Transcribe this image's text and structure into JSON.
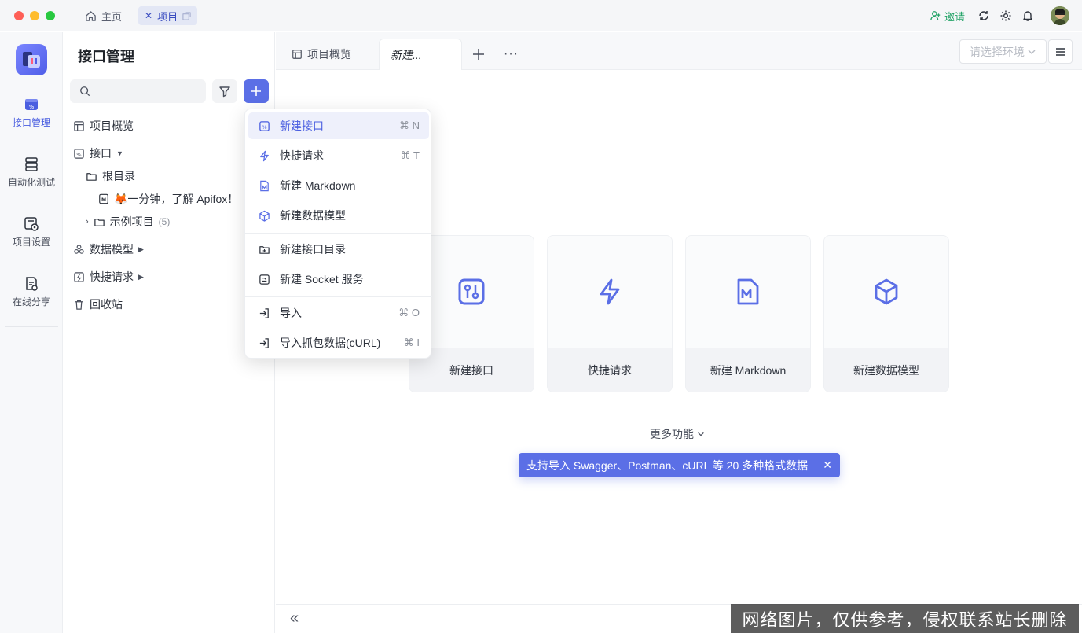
{
  "titlebar": {
    "home_label": "主页",
    "project_tab_label": "项目",
    "invite_label": "邀请"
  },
  "rail": {
    "items": [
      {
        "label": "接口管理"
      },
      {
        "label": "自动化测试"
      },
      {
        "label": "项目设置"
      },
      {
        "label": "在线分享"
      }
    ]
  },
  "sidebar": {
    "title": "接口管理",
    "search_placeholder": "",
    "tree": {
      "overview": "项目概览",
      "api": "接口",
      "root_dir": "根目录",
      "doc_item": "🦊一分钟，了解 Apifox！",
      "example_folder": "示例项目",
      "example_count": "(5)",
      "data_model": "数据模型",
      "quick_request": "快捷请求",
      "recycle": "回收站"
    }
  },
  "tabs": {
    "overview": "项目概览",
    "new": "新建..."
  },
  "env_select": {
    "placeholder": "请选择环境"
  },
  "dropdown": {
    "items": [
      {
        "label": "新建接口",
        "shortcut": "⌘ N"
      },
      {
        "label": "快捷请求",
        "shortcut": "⌘ T"
      },
      {
        "label": "新建 Markdown",
        "shortcut": ""
      },
      {
        "label": "新建数据模型",
        "shortcut": ""
      },
      {
        "label": "新建接口目录",
        "shortcut": ""
      },
      {
        "label": "新建 Socket 服务",
        "shortcut": ""
      },
      {
        "label": "导入",
        "shortcut": "⌘ O"
      },
      {
        "label": "导入抓包数据(cURL)",
        "shortcut": "⌘ I"
      }
    ]
  },
  "cards": [
    {
      "label": "新建接口",
      "icon": "api-icon"
    },
    {
      "label": "快捷请求",
      "icon": "lightning-icon"
    },
    {
      "label": "新建 Markdown",
      "icon": "markdown-icon"
    },
    {
      "label": "新建数据模型",
      "icon": "cube-icon"
    }
  ],
  "more_functions": "更多功能",
  "tooltip": "支持导入 Swagger、Postman、cURL 等 20 多种格式数据",
  "watermark": "网络图片，仅供参考，侵权联系站长删除",
  "colors": {
    "accent": "#5b6fe6",
    "invite": "#21a366"
  }
}
